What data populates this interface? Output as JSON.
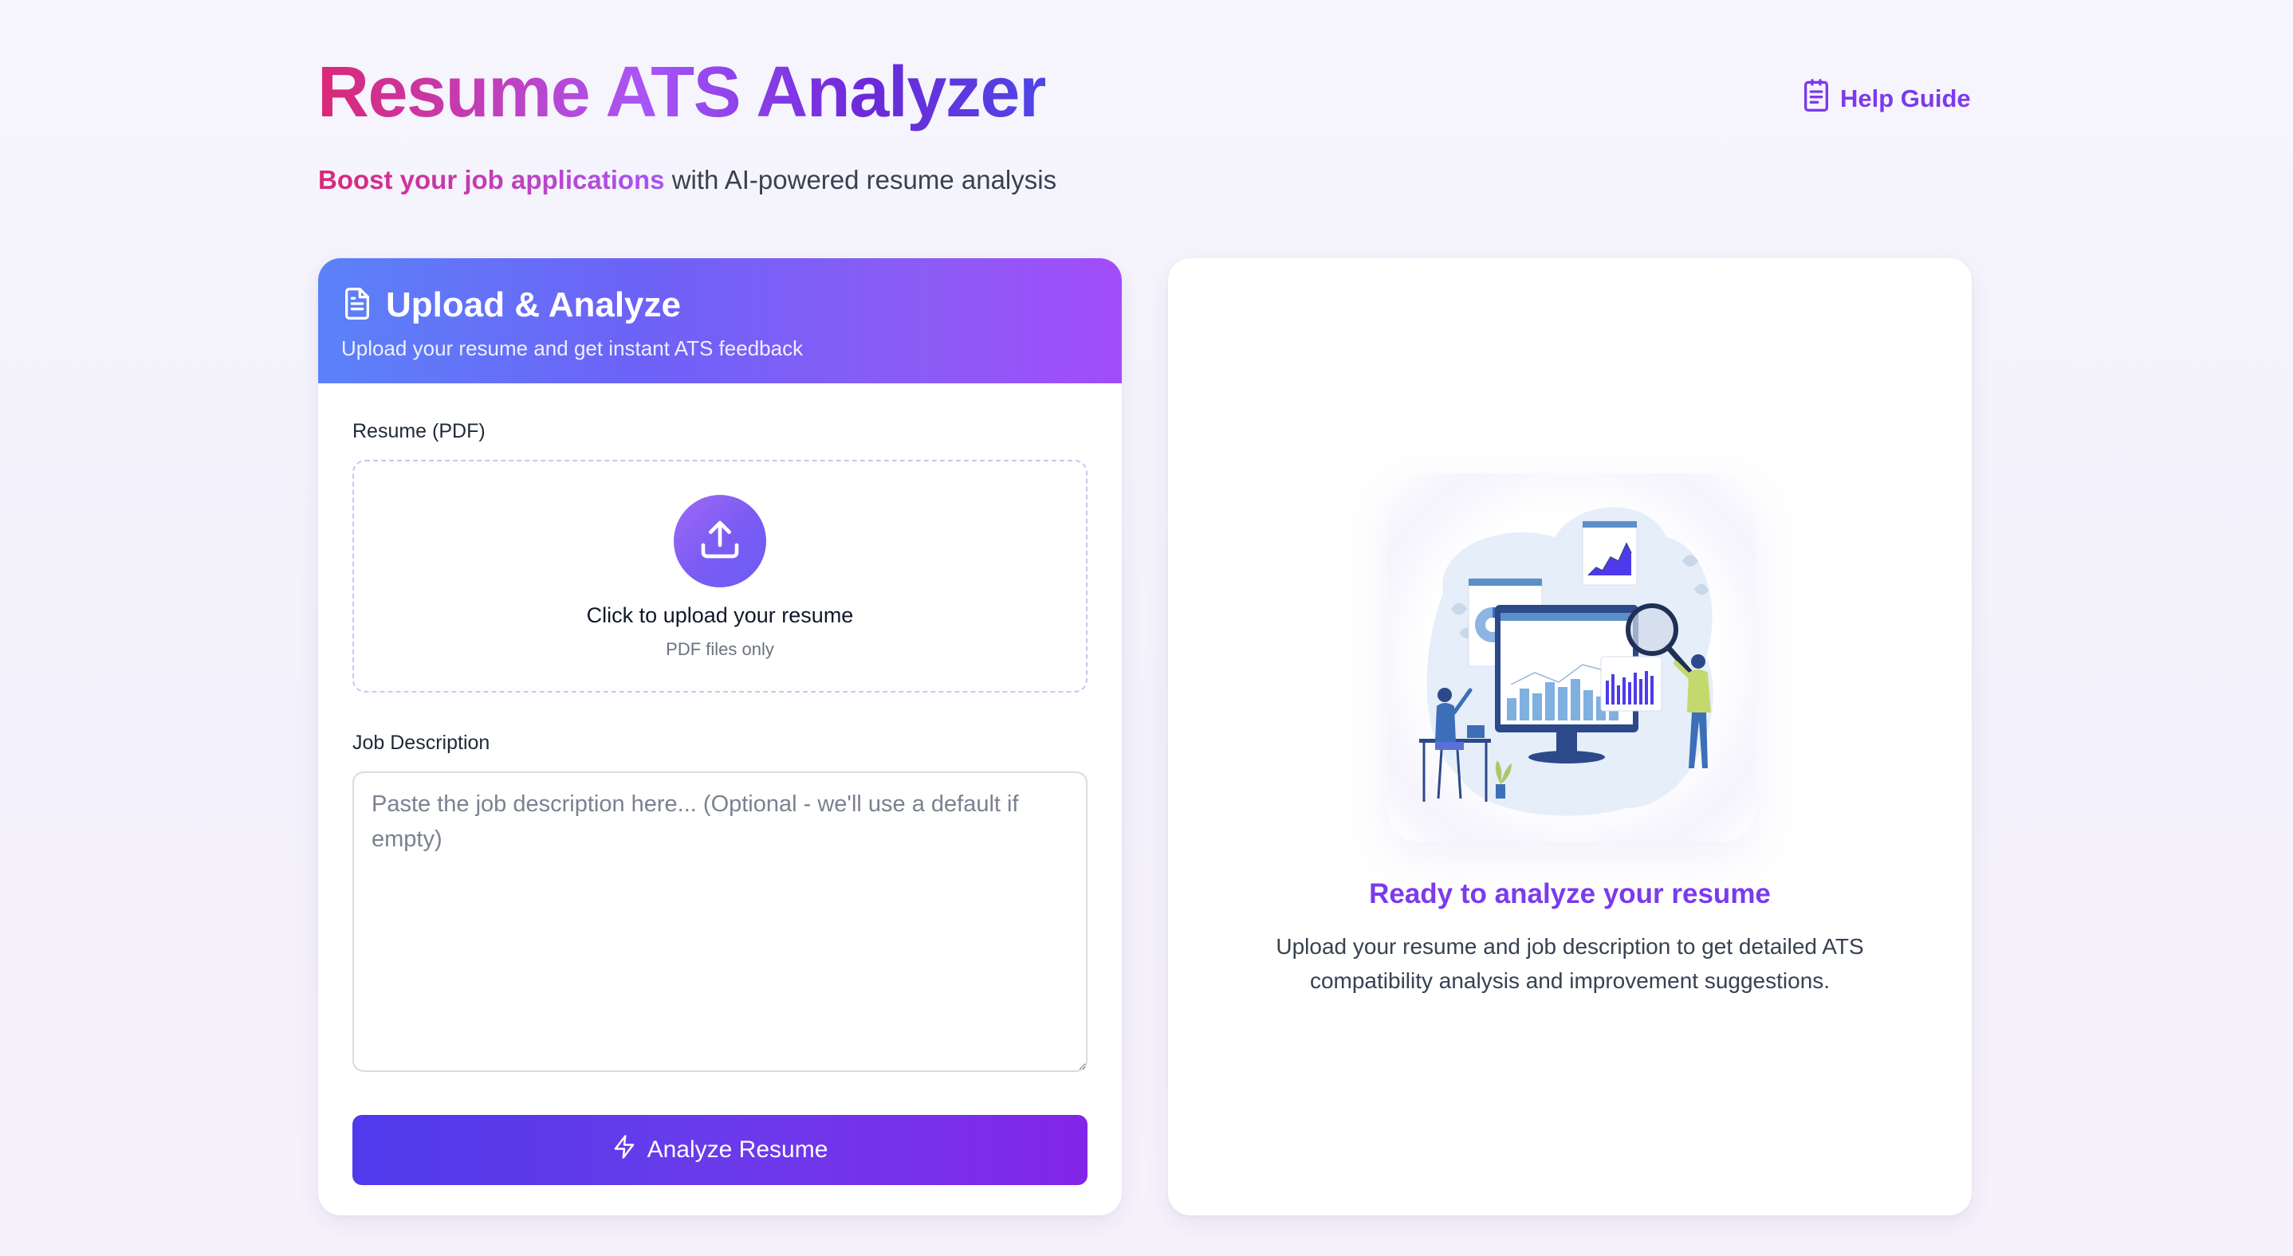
{
  "header": {
    "title": "Resume ATS Analyzer",
    "tagline_highlight": "Boost your job applications",
    "tagline_rest": " with AI-powered resume analysis",
    "help_label": "Help Guide",
    "help_icon": "clipboard-icon"
  },
  "upload_card": {
    "title": "Upload & Analyze",
    "subtitle": "Upload your resume and get instant ATS feedback",
    "title_icon": "document-icon",
    "resume_label": "Resume (PDF)",
    "dropzone_title": "Click to upload your resume",
    "dropzone_sub": "PDF files only",
    "dropzone_icon": "upload-icon",
    "jd_label": "Job Description",
    "jd_value": "",
    "jd_placeholder": "Paste the job description here... (Optional - we'll use a default if empty)",
    "analyze_label": "Analyze Resume",
    "analyze_icon": "lightning-icon"
  },
  "result_card": {
    "illustration": "data-analysis-illustration",
    "ready_title": "Ready to analyze your resume",
    "ready_text": "Upload your resume and job description to get detailed ATS compatibility analysis and improvement suggestions."
  },
  "colors": {
    "accent_purple": "#7c3aed",
    "accent_pink": "#db2777",
    "header_gradient_start": "#5b82f8",
    "header_gradient_end": "#a24cf9",
    "button_gradient_start": "#4f3aeb",
    "button_gradient_end": "#8326ea"
  }
}
